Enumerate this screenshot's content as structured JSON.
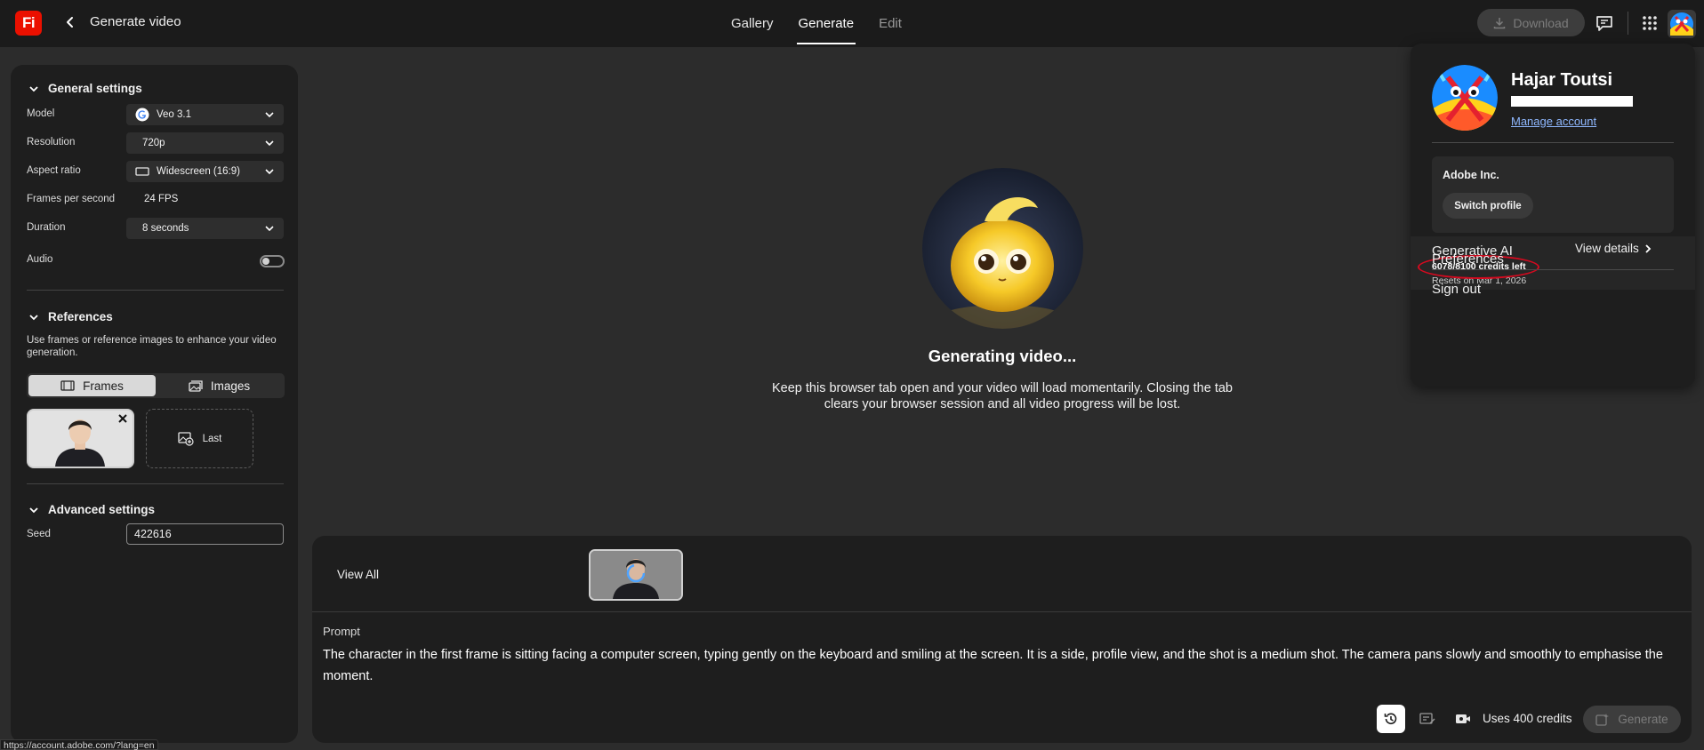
{
  "header": {
    "logo_text": "Fi",
    "title": "Generate video",
    "tabs": [
      {
        "label": "Gallery"
      },
      {
        "label": "Generate"
      },
      {
        "label": "Edit"
      }
    ],
    "download_label": "Download"
  },
  "general_settings": {
    "title": "General settings",
    "model": {
      "label": "Model",
      "value": "Veo 3.1"
    },
    "resolution": {
      "label": "Resolution",
      "value": "720p"
    },
    "aspect_ratio": {
      "label": "Aspect ratio",
      "value": "Widescreen (16:9)"
    },
    "fps": {
      "label": "Frames per second",
      "value": "24 FPS"
    },
    "duration": {
      "label": "Duration",
      "value": "8 seconds"
    },
    "audio": {
      "label": "Audio",
      "enabled": false
    }
  },
  "references": {
    "title": "References",
    "description": "Use frames or reference images to enhance your video generation.",
    "frames_tab": "Frames",
    "images_tab": "Images",
    "last_label": "Last"
  },
  "advanced_settings": {
    "title": "Advanced settings",
    "seed_label": "Seed",
    "seed_value": "422616"
  },
  "status": {
    "title": "Generating video...",
    "description": "Keep this browser tab open and your video will load momentarily. Closing the tab clears your browser session and all video progress will be lost."
  },
  "bottom": {
    "view_all": "View All",
    "prompt_label": "Prompt",
    "prompt_text": "The character in the first frame is sitting facing a computer screen, typing gently on the keyboard and smiling at the screen. It is a side, profile view, and the shot is a medium shot. The camera pans slowly and smoothly to emphasise the moment.",
    "credits": "Uses 400 credits",
    "generate_label": "Generate"
  },
  "account": {
    "name": "Hajar Toutsi",
    "manage": "Manage account",
    "org": "Adobe Inc.",
    "switch_profile": "Switch profile",
    "genai_title": "Generative AI",
    "view_details": "View details",
    "credits_left": "6078/8100 credits left",
    "resets": "Resets on Mar 1, 2026",
    "preferences": "Preferences",
    "sign_out": "Sign out"
  },
  "statusbar_url": "https://account.adobe.com/?lang=en",
  "colors": {
    "brand": "#eb1000",
    "topbar": "#1b1b1b",
    "canvas": "#2c2c2c",
    "panel": "#1e1e1e",
    "annotation": "#d40a1f",
    "link": "#8fb8ff"
  }
}
